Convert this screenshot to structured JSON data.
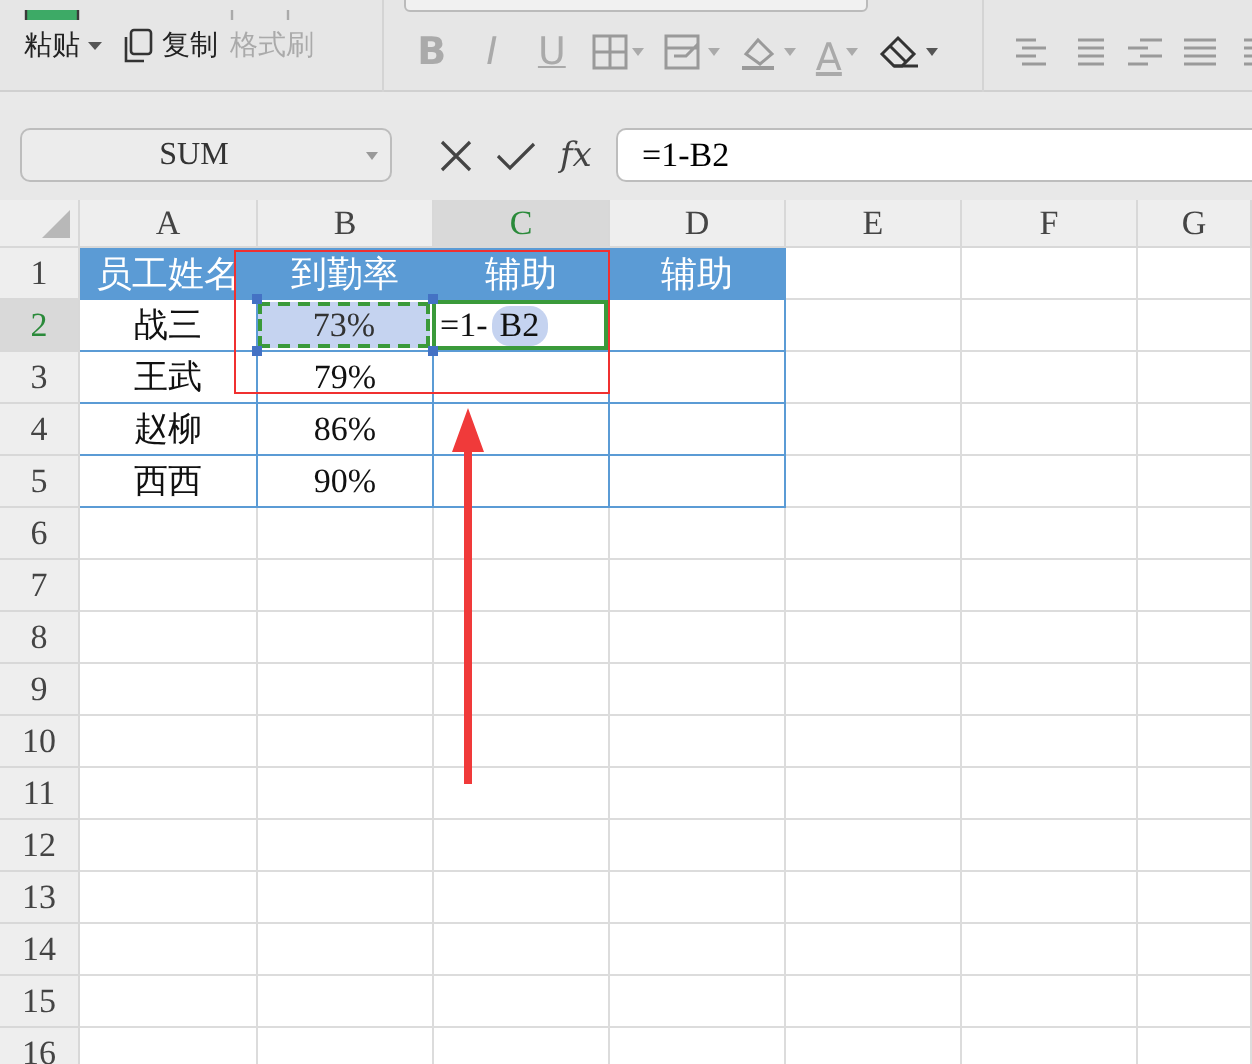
{
  "toolbar": {
    "clipboard": [
      {
        "kind": "paste",
        "label": "粘贴",
        "disabled": false
      },
      {
        "kind": "copy",
        "label": "复制",
        "disabled": false
      },
      {
        "kind": "painter",
        "label": "格式刷",
        "disabled": true
      }
    ],
    "font_buttons": [
      {
        "label": "B",
        "kind": "bold"
      },
      {
        "label": "I",
        "kind": "italic"
      },
      {
        "label": "U",
        "kind": "underline"
      }
    ],
    "font_color_label": "A"
  },
  "formula_bar": {
    "name_box": "SUM",
    "fx_label": "fx",
    "formula": "=1-B2"
  },
  "columns": [
    {
      "label": "A",
      "selected": false
    },
    {
      "label": "B",
      "selected": false
    },
    {
      "label": "C",
      "selected": true
    },
    {
      "label": "D",
      "selected": false
    },
    {
      "label": "E",
      "selected": false
    },
    {
      "label": "F",
      "selected": false
    },
    {
      "label": "G",
      "selected": false
    }
  ],
  "rows": [
    {
      "label": "1",
      "selected": false,
      "kind": "header",
      "cells": [
        {
          "kind": "text",
          "text": "员工姓名"
        },
        {
          "kind": "text",
          "text": "到勤率"
        },
        {
          "kind": "text",
          "text": "辅助"
        },
        {
          "kind": "text",
          "text": "辅助"
        }
      ]
    },
    {
      "label": "2",
      "selected": true,
      "kind": "data",
      "cells": [
        {
          "kind": "text",
          "text": "战三"
        },
        {
          "kind": "reference",
          "text": "73%"
        },
        {
          "kind": "formula",
          "text": "=1-",
          "ref": "B2"
        }
      ]
    },
    {
      "label": "3",
      "selected": false,
      "kind": "data",
      "cells": [
        {
          "kind": "text",
          "text": "王武"
        },
        {
          "kind": "text",
          "text": "79%"
        }
      ]
    },
    {
      "label": "4",
      "selected": false,
      "kind": "data",
      "cells": [
        {
          "kind": "text",
          "text": "赵柳"
        },
        {
          "kind": "text",
          "text": "86%"
        }
      ]
    },
    {
      "label": "5",
      "selected": false,
      "kind": "data",
      "cells": [
        {
          "kind": "text",
          "text": "西西"
        },
        {
          "kind": "text",
          "text": "90%"
        }
      ]
    },
    {
      "label": "6",
      "selected": false,
      "kind": "empty"
    },
    {
      "label": "7",
      "selected": false,
      "kind": "empty"
    },
    {
      "label": "8",
      "selected": false,
      "kind": "empty"
    },
    {
      "label": "9",
      "selected": false,
      "kind": "empty"
    },
    {
      "label": "10",
      "selected": false,
      "kind": "empty"
    },
    {
      "label": "11",
      "selected": false,
      "kind": "empty"
    },
    {
      "label": "12",
      "selected": false,
      "kind": "empty"
    },
    {
      "label": "13",
      "selected": false,
      "kind": "empty"
    },
    {
      "label": "14",
      "selected": false,
      "kind": "empty"
    },
    {
      "label": "15",
      "selected": false,
      "kind": "empty"
    },
    {
      "label": "16",
      "selected": false,
      "kind": "empty"
    }
  ]
}
